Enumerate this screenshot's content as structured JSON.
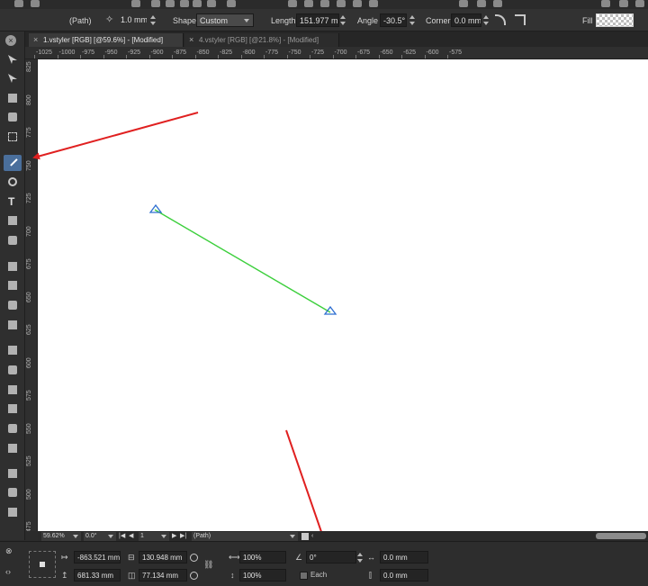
{
  "context_toolbar": {
    "object_type": "(Path)",
    "stroke_width": "1.0 mm",
    "shape_label": "Shape",
    "shape_value": "Custom",
    "length_label": "Length",
    "length_value": "151.977 mm",
    "angle_label": "Angle",
    "angle_value": "-30.5°",
    "corner_label": "Corner",
    "corner_value": "0.0 mm",
    "fill_label": "Fill"
  },
  "tabs": [
    {
      "label": "1.vstyler [RGB] [@59.6%] - [Modified]",
      "active": true
    },
    {
      "label": "4.vstyler [RGB] [@21.8%] - [Modified]",
      "active": false
    }
  ],
  "ruler": {
    "h_labels": [
      "-1025",
      "-1000",
      "-975",
      "-950",
      "-925",
      "-900",
      "-875",
      "-850",
      "-825",
      "-800",
      "-775",
      "-750",
      "-725",
      "-700",
      "-675",
      "-650",
      "-625",
      "-600",
      "-575"
    ],
    "v_labels": [
      "825",
      "800",
      "775",
      "750",
      "725",
      "700",
      "675",
      "650",
      "625",
      "600",
      "575",
      "550",
      "525",
      "500",
      "475"
    ]
  },
  "tools": [
    "pointer-icon",
    "node-tool-icon",
    "knife-icon",
    "blend-icon",
    "marquee-icon",
    "line-tool-icon",
    "ellipse-tool-icon",
    "text-tool-icon",
    "fill-tool-icon",
    "eyedropper-icon",
    "brush-icon",
    "perspective-icon",
    "rectangle-icon",
    "image-icon",
    "gradient-icon",
    "pattern-icon",
    "grid-icon",
    "frame-icon",
    "shape-builder-icon",
    "stamp-icon",
    "spray-icon",
    "artboard-icon",
    "zoom-icon"
  ],
  "status_bar": {
    "zoom": "59.62%",
    "rotation": "0.0°",
    "page": "1",
    "selection": "(Path)"
  },
  "transform_panel": {
    "x": "-863.521 mm",
    "y": "681.33 mm",
    "width": "130.948 mm",
    "height": "77.134 mm",
    "scale_x": "100%",
    "scale_y": "100%",
    "rotation": "0°",
    "each_label": "Each",
    "skew_x": "0.0 mm",
    "skew_y": "0.0 mm"
  },
  "colors": {
    "line_stroke": "#3ccf3c",
    "arrowhead": "#2f6fd1",
    "annotation_arrow": "#e02020",
    "active_tool": "#4a6f9c"
  }
}
